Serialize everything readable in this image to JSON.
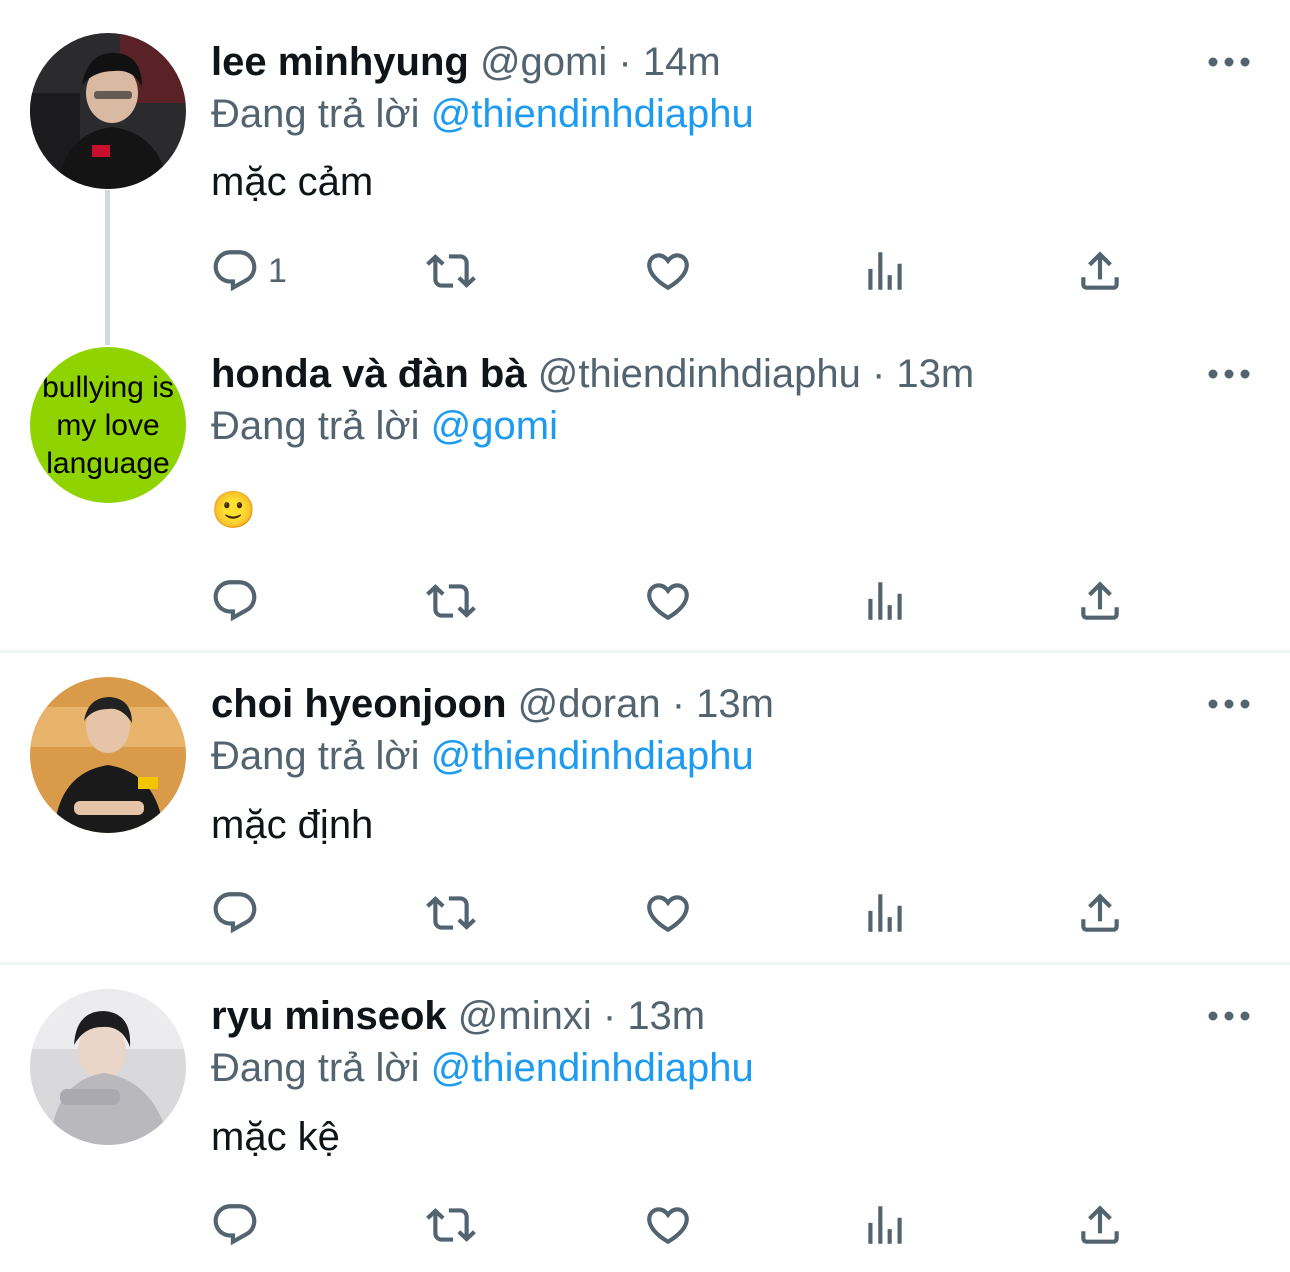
{
  "tweets": [
    {
      "name": "lee minhyung",
      "handle": "@gomi",
      "separator": "·",
      "time": "14m",
      "reply_prefix": "Đang trả lời",
      "reply_to": "@thiendinhdiaphu",
      "text": "mặc cảm",
      "reply_count": "1"
    },
    {
      "name": "honda và đàn bà",
      "handle": "@thiendinhdiaphu",
      "separator": "·",
      "time": "13m",
      "reply_prefix": "Đang trả lời",
      "reply_to": "@gomi",
      "text": "🙂",
      "avatar_text": [
        "bullying is",
        "my love",
        "language"
      ]
    },
    {
      "name": "choi hyeonjoon",
      "handle": "@doran",
      "separator": "·",
      "time": "13m",
      "reply_prefix": "Đang trả lời",
      "reply_to": "@thiendinhdiaphu",
      "text": "mặc định"
    },
    {
      "name": "ryu minseok",
      "handle": "@minxi",
      "separator": "·",
      "time": "13m",
      "reply_prefix": "Đang trả lời",
      "reply_to": "@thiendinhdiaphu",
      "text": "mặc kệ"
    }
  ],
  "colors": {
    "link": "#1d9bf0",
    "secondary_text": "#536471",
    "primary_text": "#0f1419",
    "divider": "#eff3f4",
    "thread_line": "#cfd9de"
  },
  "icons": [
    "reply-icon",
    "retweet-icon",
    "like-icon",
    "views-icon",
    "share-icon",
    "more-icon"
  ]
}
